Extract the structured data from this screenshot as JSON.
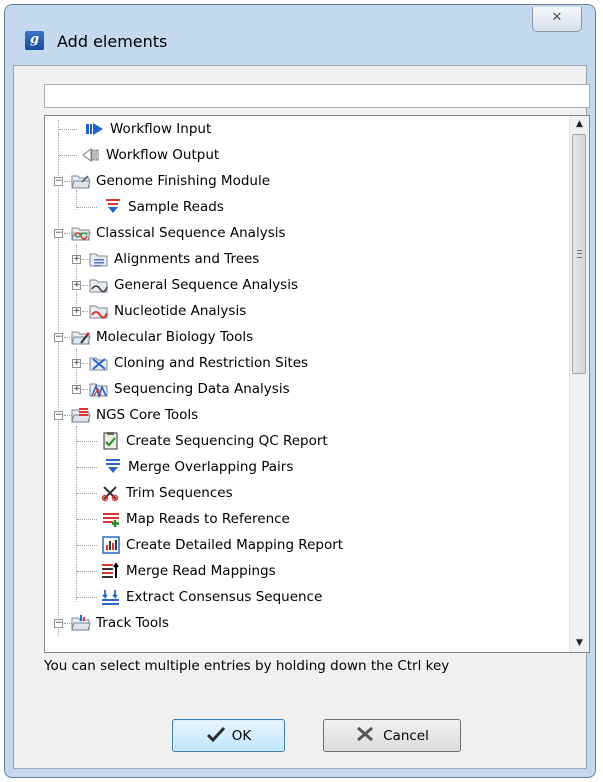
{
  "window": {
    "title": "Add elements",
    "close_glyph": "✕",
    "app_icon_glyph": "g"
  },
  "filter": {
    "value": "",
    "placeholder": ""
  },
  "tree": {
    "items": [
      {
        "label": "Workflow Input",
        "icon": "workflow-input-icon"
      },
      {
        "label": "Workflow Output",
        "icon": "workflow-output-icon"
      },
      {
        "label": "Genome Finishing Module",
        "icon": "genome-finishing-folder-icon",
        "expanded": true
      },
      {
        "label": "Sample Reads",
        "icon": "sample-reads-icon"
      },
      {
        "label": "Classical Sequence Analysis",
        "icon": "classical-sequence-folder-icon",
        "expanded": true
      },
      {
        "label": "Alignments and Trees",
        "icon": "alignments-folder-icon",
        "expanded": false
      },
      {
        "label": "General Sequence Analysis",
        "icon": "general-sequence-folder-icon",
        "expanded": false
      },
      {
        "label": "Nucleotide Analysis",
        "icon": "nucleotide-folder-icon",
        "expanded": false
      },
      {
        "label": "Molecular Biology Tools",
        "icon": "molecular-biology-folder-icon",
        "expanded": true
      },
      {
        "label": "Cloning and Restriction Sites",
        "icon": "cloning-folder-icon",
        "expanded": false
      },
      {
        "label": "Sequencing Data Analysis",
        "icon": "sequencing-folder-icon",
        "expanded": false
      },
      {
        "label": "NGS Core Tools",
        "icon": "ngs-core-folder-icon",
        "expanded": true
      },
      {
        "label": "Create Sequencing QC Report",
        "icon": "qc-report-icon"
      },
      {
        "label": "Merge Overlapping Pairs",
        "icon": "merge-pairs-icon"
      },
      {
        "label": "Trim Sequences",
        "icon": "trim-sequences-icon"
      },
      {
        "label": "Map Reads to Reference",
        "icon": "map-reads-icon"
      },
      {
        "label": "Create Detailed Mapping Report",
        "icon": "mapping-report-icon"
      },
      {
        "label": "Merge Read Mappings",
        "icon": "merge-mappings-icon"
      },
      {
        "label": "Extract Consensus Sequence",
        "icon": "consensus-icon"
      },
      {
        "label": "Track Tools",
        "icon": "track-tools-folder-icon",
        "expanded": true
      }
    ]
  },
  "hint": "You can select multiple entries by holding down the Ctrl key",
  "buttons": {
    "ok": "OK",
    "cancel": "Cancel"
  },
  "colors": {
    "frame": "#c4d9ee",
    "ok_accent": "#3c7fb1"
  }
}
